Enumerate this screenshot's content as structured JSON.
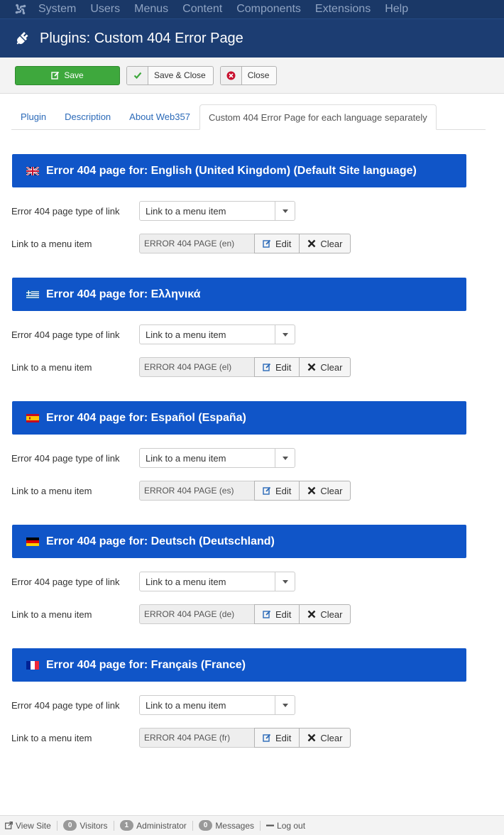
{
  "topnav": {
    "logo_icon": "joomla-logo-icon",
    "items": [
      "System",
      "Users",
      "Menus",
      "Content",
      "Components",
      "Extensions",
      "Help"
    ]
  },
  "header": {
    "icon": "plug-icon",
    "title": "Plugins: Custom 404 Error Page"
  },
  "toolbar": {
    "save_label": "Save",
    "save_close_label": "Save & Close",
    "close_label": "Close"
  },
  "tabs": [
    {
      "label": "Plugin",
      "active": false
    },
    {
      "label": "Description",
      "active": false
    },
    {
      "label": "About Web357",
      "active": false
    },
    {
      "label": "Custom 404 Error Page for each language separately",
      "active": true
    }
  ],
  "sections": [
    {
      "flag": "uk-flag-icon",
      "title": "Error 404 page for: English (United Kingdom) (Default Site language)",
      "type_label": "Error 404 page type of link",
      "type_value": "Link to a menu item",
      "item_label": "Link to a menu item",
      "item_value": "ERROR 404 PAGE (en)",
      "edit_label": "Edit",
      "clear_label": "Clear"
    },
    {
      "flag": "greece-flag-icon",
      "title": "Error 404 page for: Ελληνικά",
      "type_label": "Error 404 page type of link",
      "type_value": "Link to a menu item",
      "item_label": "Link to a menu item",
      "item_value": "ERROR 404 PAGE (el)",
      "edit_label": "Edit",
      "clear_label": "Clear"
    },
    {
      "flag": "spain-flag-icon",
      "title": "Error 404 page for: Español (España)",
      "type_label": "Error 404 page type of link",
      "type_value": "Link to a menu item",
      "item_label": "Link to a menu item",
      "item_value": "ERROR 404 PAGE (es)",
      "edit_label": "Edit",
      "clear_label": "Clear"
    },
    {
      "flag": "germany-flag-icon",
      "title": "Error 404 page for: Deutsch (Deutschland)",
      "type_label": "Error 404 page type of link",
      "type_value": "Link to a menu item",
      "item_label": "Link to a menu item",
      "item_value": "ERROR 404 PAGE (de)",
      "edit_label": "Edit",
      "clear_label": "Clear"
    },
    {
      "flag": "france-flag-icon",
      "title": "Error 404 page for: Français (France)",
      "type_label": "Error 404 page type of link",
      "type_value": "Link to a menu item",
      "item_label": "Link to a menu item",
      "item_value": "ERROR 404 PAGE (fr)",
      "edit_label": "Edit",
      "clear_label": "Clear"
    }
  ],
  "statusbar": {
    "view_site": "View Site",
    "visitors_count": "0",
    "visitors_label": "Visitors",
    "admin_count": "1",
    "admin_label": "Administrator",
    "messages_count": "0",
    "messages_label": "Messages",
    "logout": "Log out"
  },
  "colors": {
    "nav_bg": "#1a3867",
    "header_bg": "#1c3d72",
    "section_bar": "#1055c8",
    "save_green": "#3ea83d",
    "link_blue": "#2a69b8"
  }
}
